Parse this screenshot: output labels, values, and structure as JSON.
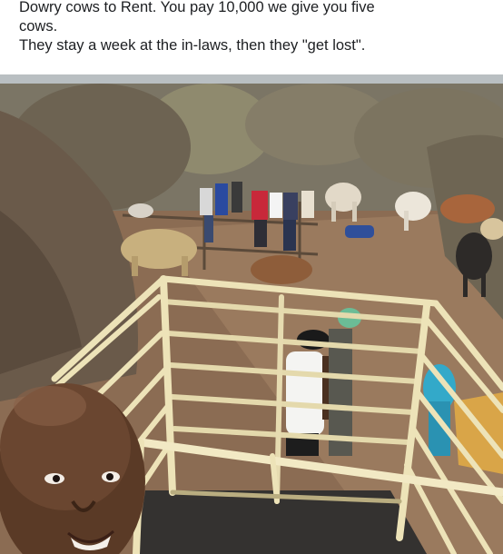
{
  "post": {
    "caption_line_1": "Dowry cows to Rent. You pay 10,000 we give you five",
    "caption_line_2": "cows.",
    "caption_line_3": "They stay a week at the in-laws, then they \"get lost\"."
  },
  "photo": {
    "subject": "selfie man in front of cattle crate with cows in kraal",
    "colors": {
      "sky": "#b9bfc2",
      "bush": "#7e7461",
      "ground": "#8d6e52",
      "crate": "#ede3b8",
      "crate_shadow": "#b9ad80"
    }
  }
}
